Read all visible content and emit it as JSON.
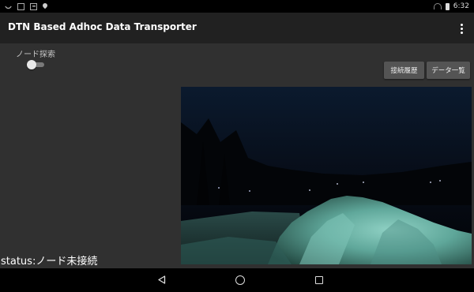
{
  "statusbar": {
    "time": "6:32",
    "icons": [
      "signal-icon",
      "image-icon",
      "document-icon",
      "pin-icon",
      "wifi-icon",
      "battery-icon"
    ]
  },
  "appbar": {
    "title": "DTN Based Adhoc Data Transporter",
    "overflow_icon": "overflow-menu-icon"
  },
  "main": {
    "switch_label": "ノード探索",
    "switch_on": false,
    "history_button": "接続履歴",
    "data_list_button": "データ一覧",
    "status": "status:ノード未接続",
    "preview_image": "camera-preview-night-snow"
  },
  "navbar": {
    "icons": [
      "back-icon",
      "home-icon",
      "recents-icon"
    ]
  },
  "colors": {
    "appbar": "#212121",
    "content": "#303030",
    "button": "#545454"
  }
}
